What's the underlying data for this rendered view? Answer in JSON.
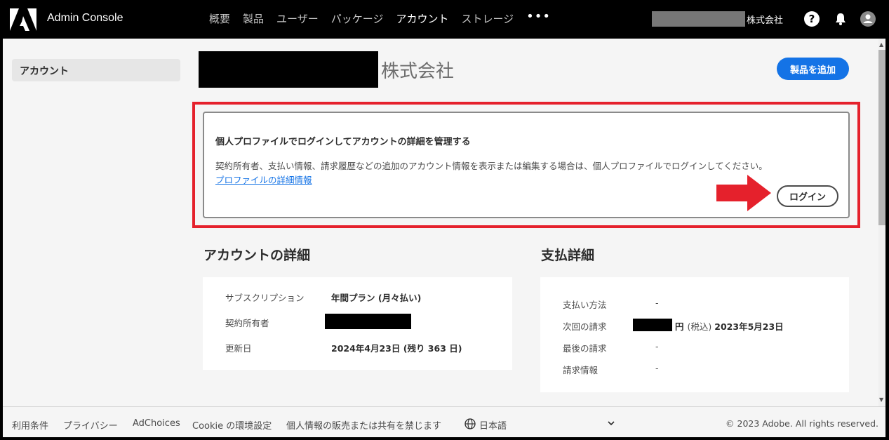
{
  "header": {
    "app_title": "Admin Console",
    "nav": [
      "概要",
      "製品",
      "ユーザー",
      "パッケージ",
      "アカウント",
      "ストレージ"
    ],
    "nav_more": "•••",
    "org_suffix": "株式会社",
    "icons": [
      "help-icon",
      "bell-icon",
      "user-avatar-icon"
    ]
  },
  "sidebar": {
    "items": [
      {
        "label": "アカウント"
      }
    ]
  },
  "main": {
    "org_title_suffix": "株式会社",
    "add_product_label": "製品を追加",
    "notice": {
      "heading": "個人プロファイルでログインしてアカウントの詳細を管理する",
      "body": "契約所有者、支払い情報、請求履歴などの追加のアカウント情報を表示または編集する場合は、個人プロファイルでログインしてください。",
      "link": "プロファイルの詳細情報",
      "login_label": "ログイン"
    },
    "account": {
      "title": "アカウントの詳細",
      "rows": [
        {
          "label": "サブスクリプション",
          "value": "年間プラン (月々払い)"
        },
        {
          "label": "契約所有者",
          "value": ""
        },
        {
          "label": "更新日",
          "value": "2024年4月23日 (残り 363 日)"
        }
      ]
    },
    "payment": {
      "title": "支払詳細",
      "rows": [
        {
          "label": "支払い方法",
          "value": "-"
        },
        {
          "label": "次回の請求",
          "value_suffix": "円",
          "tax": "(税込)",
          "date": "2023年5月23日"
        },
        {
          "label": "最後の請求",
          "value": "-"
        },
        {
          "label": "請求情報",
          "value": "-"
        }
      ]
    }
  },
  "footer": {
    "links": [
      "利用条件",
      "プライバシー",
      "AdChoices",
      "Cookie の環境設定",
      "個人情報の販売または共有を禁じます"
    ],
    "language": "日本語",
    "copyright": "© 2023 Adobe. All rights reserved."
  },
  "colors": {
    "accent": "#1473e6",
    "highlight": "#e5212c"
  }
}
